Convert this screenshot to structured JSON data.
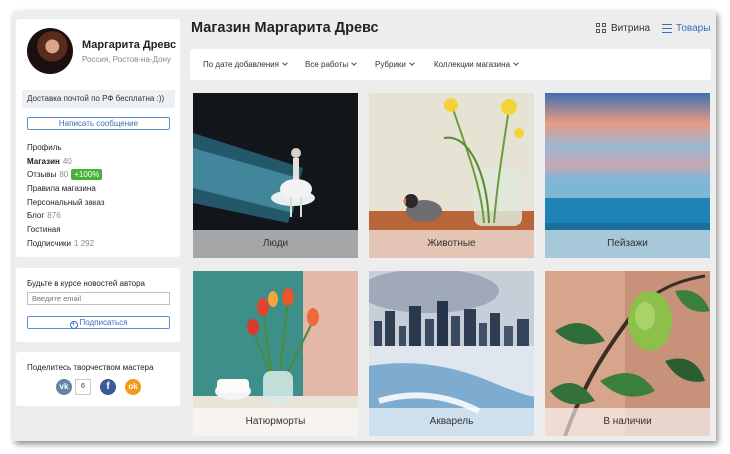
{
  "profile": {
    "name": "Маргарита Древс",
    "location": "Россия, Ростов-на-Дону",
    "delivery_note": "Доставка почтой по РФ бесплатна :))",
    "message_button": "Написать сообщение",
    "menu": [
      {
        "label": "Профиль",
        "count": "",
        "bold": false
      },
      {
        "label": "Магазин",
        "count": "40",
        "bold": true
      },
      {
        "label": "Отзывы",
        "count": "80",
        "badge": "+100%",
        "bold": false
      },
      {
        "label": "Правила магазина",
        "count": "",
        "bold": false
      },
      {
        "label": "Персональный заказ",
        "count": "",
        "bold": false
      },
      {
        "label": "Блог",
        "count": "876",
        "bold": false
      },
      {
        "label": "Гостиная",
        "count": "",
        "bold": false
      },
      {
        "label": "Подписчики",
        "count": "1 292",
        "bold": false
      }
    ]
  },
  "newsletter": {
    "title": "Будьте в курсе новостей автора",
    "email_placeholder": "Введите email",
    "subscribe_button": "Подписаться"
  },
  "share": {
    "title": "Поделитесь творчеством мастера",
    "vk_count": "6",
    "icons": [
      "vk-icon",
      "facebook-icon",
      "odnoklassniki-icon"
    ]
  },
  "header": {
    "title": "Магазин Маргарита Древс",
    "view_vitrina": "Витрина",
    "view_goods": "Товары",
    "active_view": "Товары",
    "accent_color": "#3a6fb8"
  },
  "filters": [
    "По дате добавления",
    "Все работы",
    "Рубрики",
    "Коллекции магазина"
  ],
  "categories": [
    {
      "label": "Люди"
    },
    {
      "label": "Животные"
    },
    {
      "label": "Пейзажи"
    },
    {
      "label": "Натюрморты"
    },
    {
      "label": "Акварель"
    },
    {
      "label": "В наличии"
    }
  ]
}
